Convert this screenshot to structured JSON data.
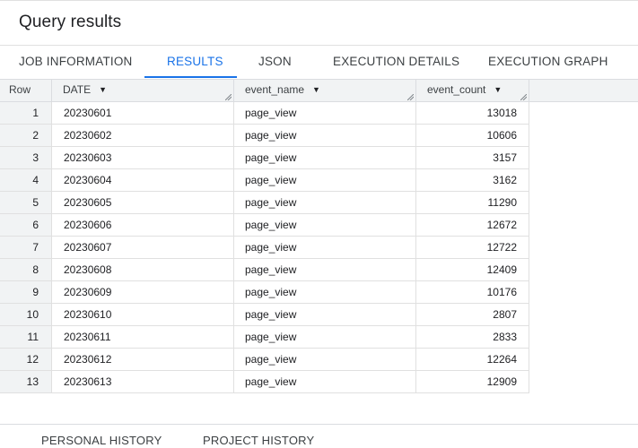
{
  "panel": {
    "title": "Query results"
  },
  "tabs": [
    {
      "label": "JOB INFORMATION"
    },
    {
      "label": "RESULTS"
    },
    {
      "label": "JSON"
    },
    {
      "label": "EXECUTION DETAILS"
    },
    {
      "label": "EXECUTION GRAPH"
    }
  ],
  "active_tab": "RESULTS",
  "table": {
    "columns": [
      {
        "label": "Row"
      },
      {
        "label": "DATE"
      },
      {
        "label": "event_name"
      },
      {
        "label": "event_count"
      }
    ],
    "rows": [
      {
        "row": "1",
        "date": "20230601",
        "event_name": "page_view",
        "event_count": "13018"
      },
      {
        "row": "2",
        "date": "20230602",
        "event_name": "page_view",
        "event_count": "10606"
      },
      {
        "row": "3",
        "date": "20230603",
        "event_name": "page_view",
        "event_count": "3157"
      },
      {
        "row": "4",
        "date": "20230604",
        "event_name": "page_view",
        "event_count": "3162"
      },
      {
        "row": "5",
        "date": "20230605",
        "event_name": "page_view",
        "event_count": "11290"
      },
      {
        "row": "6",
        "date": "20230606",
        "event_name": "page_view",
        "event_count": "12672"
      },
      {
        "row": "7",
        "date": "20230607",
        "event_name": "page_view",
        "event_count": "12722"
      },
      {
        "row": "8",
        "date": "20230608",
        "event_name": "page_view",
        "event_count": "12409"
      },
      {
        "row": "9",
        "date": "20230609",
        "event_name": "page_view",
        "event_count": "10176"
      },
      {
        "row": "10",
        "date": "20230610",
        "event_name": "page_view",
        "event_count": "2807"
      },
      {
        "row": "11",
        "date": "20230611",
        "event_name": "page_view",
        "event_count": "2833"
      },
      {
        "row": "12",
        "date": "20230612",
        "event_name": "page_view",
        "event_count": "12264"
      },
      {
        "row": "13",
        "date": "20230613",
        "event_name": "page_view",
        "event_count": "12909"
      }
    ]
  },
  "history_tabs": [
    {
      "label": "PERSONAL HISTORY"
    },
    {
      "label": "PROJECT HISTORY"
    }
  ],
  "colors": {
    "accent": "#1a73e8",
    "header_bg": "#f1f3f4",
    "divider": "#dadce0"
  },
  "icons": {
    "sort": "arrow-drop-down-icon",
    "resize": "column-resize-handle-icon"
  }
}
